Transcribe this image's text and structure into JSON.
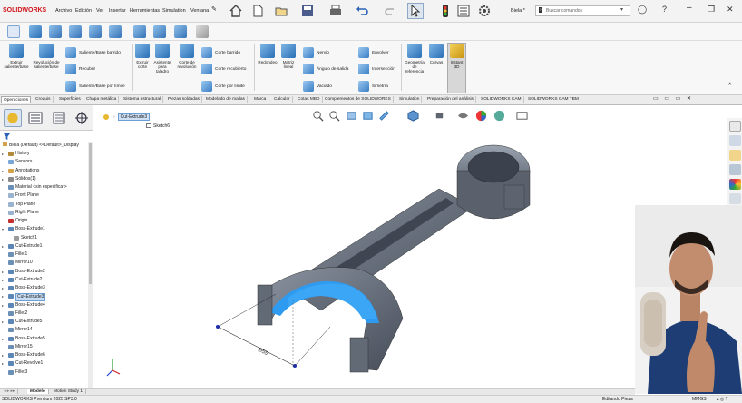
{
  "app": {
    "logo_text": "SOLIDWORKS",
    "menus": [
      "Archivo",
      "Edición",
      "Ver",
      "Insertar",
      "Herramientas",
      "Simulation",
      "Ventana"
    ],
    "search_placeholder": "Buscar comandos",
    "doc_title": "Biela *"
  },
  "ribbon": {
    "extrude": "Extruir saliente/base",
    "revolve": "Revolución de saliente/base",
    "swept": "Saliente/Base barrido",
    "loft": "Recubrir",
    "boundary": "Saliente/Base por límite",
    "extruded_cut": "Extruir corte",
    "hole_wizard": "Asistente para taladro",
    "revolved_cut": "Corte de revolución",
    "swept_cut": "Corte barrido",
    "lofted_cut": "Corte recubierto",
    "boundary_cut": "Corte por límite",
    "fillet": "Redondeo",
    "linear_pattern": "Matriz lineal",
    "rib": "Nervio",
    "draft": "Ángulo de salida",
    "shell": "Vaciado",
    "wrap": "Envolver",
    "intersect": "Intersección",
    "mirror": "Simetría",
    "ref_geometry": "Geometría de referencia",
    "curves": "Curvas",
    "instant3d": "Instant 3D"
  },
  "tabs": [
    "Operaciones",
    "Croquis",
    "Superficies",
    "Chapa metálica",
    "Sistema estructural",
    "Piezas soldadas",
    "Modelado de mallas",
    "Marca",
    "Calcular",
    "Cotas MBD",
    "Complementos de SOLIDWORKS",
    "Simulation",
    "Preparación del análisis",
    "SOLIDWORKS CAM",
    "SOLIDWORKS CAM TBM"
  ],
  "tree": {
    "root": "Biela (Default) <<Default>_Display",
    "items": [
      {
        "label": "History",
        "icon": "history-icon",
        "exp": "▸",
        "color": "#b38b3c"
      },
      {
        "label": "Sensors",
        "icon": "sensor-icon",
        "exp": "",
        "color": "#7aa6d6"
      },
      {
        "label": "Annotations",
        "icon": "annotation-icon",
        "exp": "▸",
        "color": "#d4a24a"
      },
      {
        "label": "Sólidos(1)",
        "icon": "solid-bodies-icon",
        "exp": "▸",
        "color": "#8a8a8a"
      },
      {
        "label": "Material <sin especificar>",
        "icon": "material-icon",
        "exp": "",
        "color": "#6a8fb8"
      },
      {
        "label": "Front Plane",
        "icon": "plane-icon",
        "exp": "",
        "color": "#9ab3cf"
      },
      {
        "label": "Top Plane",
        "icon": "plane-icon",
        "exp": "",
        "color": "#9ab3cf"
      },
      {
        "label": "Right Plane",
        "icon": "plane-icon",
        "exp": "",
        "color": "#9ab3cf"
      },
      {
        "label": "Origin",
        "icon": "origin-icon",
        "exp": "",
        "color": "#c43030"
      },
      {
        "label": "Boss-Extrude1",
        "icon": "boss-extrude-icon",
        "exp": "▾",
        "color": "#5b86b6"
      },
      {
        "label": "Sketch1",
        "icon": "sketch-icon",
        "exp": "",
        "color": "#9a9a9a",
        "indent": true
      },
      {
        "label": "Cut-Extrude1",
        "icon": "cut-extrude-icon",
        "exp": "▸",
        "color": "#5b86b6"
      },
      {
        "label": "Fillet1",
        "icon": "fillet-icon",
        "exp": "",
        "color": "#6b8fb5"
      },
      {
        "label": "Mirror10",
        "icon": "mirror-icon",
        "exp": "",
        "color": "#6b8fb5"
      },
      {
        "label": "Boss-Extrude2",
        "icon": "boss-extrude-icon",
        "exp": "▸",
        "color": "#5b86b6"
      },
      {
        "label": "Cut-Extrude2",
        "icon": "cut-extrude-icon",
        "exp": "▸",
        "color": "#5b86b6"
      },
      {
        "label": "Boss-Extrude3",
        "icon": "boss-extrude-icon",
        "exp": "▸",
        "color": "#5b86b6"
      },
      {
        "label": "Cut-Extrude3",
        "icon": "cut-extrude-icon",
        "exp": "▸",
        "color": "#5b86b6",
        "selected": true
      },
      {
        "label": "Boss-Extrude4",
        "icon": "boss-extrude-icon",
        "exp": "▸",
        "color": "#5b86b6"
      },
      {
        "label": "Fillet2",
        "icon": "fillet-icon",
        "exp": "",
        "color": "#6b8fb5"
      },
      {
        "label": "Cut-Extrude5",
        "icon": "cut-extrude-icon",
        "exp": "▸",
        "color": "#5b86b6"
      },
      {
        "label": "Mirror14",
        "icon": "mirror-icon",
        "exp": "",
        "color": "#6b8fb5"
      },
      {
        "label": "Boss-Extrude5",
        "icon": "boss-extrude-icon",
        "exp": "▸",
        "color": "#5b86b6"
      },
      {
        "label": "Mirror15",
        "icon": "mirror-icon",
        "exp": "",
        "color": "#6b8fb5"
      },
      {
        "label": "Boss-Extrude6",
        "icon": "boss-extrude-icon",
        "exp": "▸",
        "color": "#5b86b6"
      },
      {
        "label": "Cut-Revolve1",
        "icon": "cut-revolve-icon",
        "exp": "▸",
        "color": "#5b86b6"
      },
      {
        "label": "Fillet3",
        "icon": "fillet-icon",
        "exp": "",
        "color": "#6b8fb5"
      }
    ]
  },
  "viewport": {
    "breadcrumb_feature": "Cut-Extrude3",
    "breadcrumb_sketch": "Sketch6",
    "dimension": "Ø55",
    "highlight_color": "#2f9bf0",
    "part_color": "#5f6672"
  },
  "bottom_tabs": [
    "Modelo",
    "Motion Study 1"
  ],
  "status": {
    "product": "SOLIDWORKS Premium 2025 SP3.0",
    "mode": "Editando Pieza",
    "units": "MMGS"
  }
}
